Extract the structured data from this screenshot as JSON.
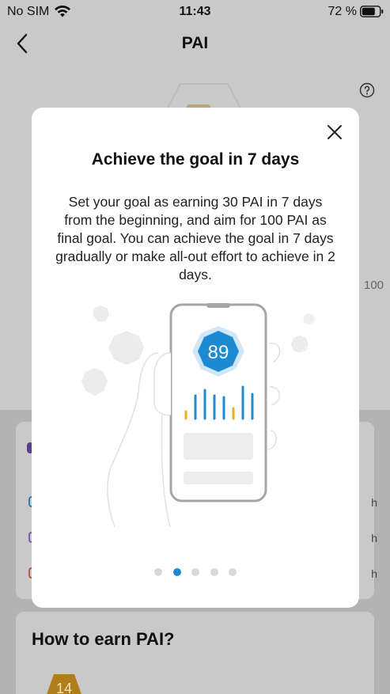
{
  "status_bar": {
    "carrier": "No SIM",
    "time": "11:43",
    "battery": "72 %"
  },
  "nav": {
    "title": "PAI"
  },
  "background": {
    "gauge_max": "100",
    "section_title": "How to earn PAI?",
    "badge_value": "14"
  },
  "modal": {
    "title": "Achieve the goal in 7 days",
    "body": "Set your goal as earning 30 PAI in 7 days from the beginning, and aim for 100 PAI as final goal. You can achieve the goal in 7 days gradually or make all-out effort to achieve in 2 days.",
    "phone_score": "89",
    "page_count": 5,
    "active_page": 1,
    "accent_color": "#1d8bd3",
    "bar_colors": [
      "#f0ad1a",
      "#1d8bd3"
    ]
  }
}
